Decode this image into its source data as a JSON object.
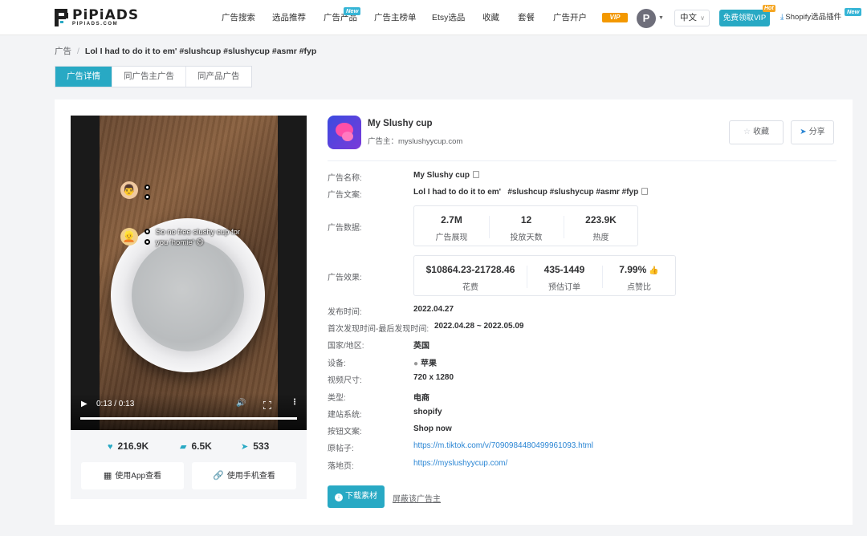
{
  "header": {
    "logo_text": "PiPiADS",
    "logo_sub": "PIPIADS.COM",
    "nav": [
      {
        "label": "广告搜索"
      },
      {
        "label": "选品推荐"
      },
      {
        "label": "广告产品",
        "tag": "New"
      },
      {
        "label": "广告主榜单"
      },
      {
        "label": "Etsy选品"
      },
      {
        "label": "收藏"
      },
      {
        "label": "套餐"
      },
      {
        "label": "广告开户"
      }
    ],
    "vip_badge": "VIP",
    "avatar_letter": "P",
    "language": "中文",
    "free_vip_button": "免费领取VIP",
    "free_vip_tag": "Hot",
    "plugin_link": "Shopify选品插件",
    "plugin_tag": "New"
  },
  "breadcrumb": {
    "root": "广告",
    "current": "Lol I had to do it to em' #slushcup #slushycup #asmr #fyp"
  },
  "tabs": [
    {
      "label": "广告详情",
      "active": true
    },
    {
      "label": "同广告主广告",
      "active": false
    },
    {
      "label": "同产品广告",
      "active": false
    }
  ],
  "video": {
    "caption_line1": "So no free slushy cup for",
    "caption_line2": "you 'homie' 😄",
    "time": "0:13 / 0:13",
    "progress": 1.0
  },
  "engagement": {
    "likes": "216.9K",
    "comments": "6.5K",
    "shares": "533",
    "app_view": "使用App查看",
    "phone_view": "使用手机查看"
  },
  "advertiser": {
    "name": "My Slushy cup",
    "label": "广告主：",
    "domain": "myslushyycup.com",
    "favorite": "收藏",
    "share": "分享"
  },
  "details": {
    "ad_name_label": "广告名称:",
    "ad_name": "My Slushy cup",
    "ad_copy_label": "广告文案:",
    "ad_copy": "Lol I had to do it to em'   #slushcup #slushycup #asmr #fyp",
    "ad_data_label": "广告数据:",
    "ad_data": [
      {
        "value": "2.7M",
        "label": "广告展现"
      },
      {
        "value": "12",
        "label": "投放天数"
      },
      {
        "value": "223.9K",
        "label": "热度"
      }
    ],
    "ad_effect_label": "广告效果:",
    "ad_effect": [
      {
        "value": "$10864.23-21728.46",
        "label": "花费"
      },
      {
        "value": "435-1449",
        "label": "预估订单"
      },
      {
        "value": "7.99%",
        "label": "点赞比"
      }
    ],
    "publish_label": "发布时间:",
    "publish": "2022.04.27",
    "seen_label": "首次发现时间-最后发现时间:",
    "seen": "2022.04.28 ~ 2022.05.09",
    "country_label": "国家/地区:",
    "country": "英国",
    "device_label": "设备:",
    "device": "苹果",
    "size_label": "视频尺寸:",
    "size": "720 x 1280",
    "type_label": "类型:",
    "type": "电商",
    "platform_label": "建站系统:",
    "platform": "shopify",
    "button_label": "按钮文案:",
    "button_text": "Shop now",
    "source_label": "原帖子:",
    "source": "https://m.tiktok.com/v/7090984480499961093.html",
    "landing_label": "落地页:",
    "landing": "https://myslushyycup.com/"
  },
  "actions": {
    "download": "下载素材",
    "block": "屏蔽该广告主"
  },
  "colors": {
    "accent": "#28a9c4",
    "link": "#2b86d4",
    "vip": "#f39800"
  }
}
